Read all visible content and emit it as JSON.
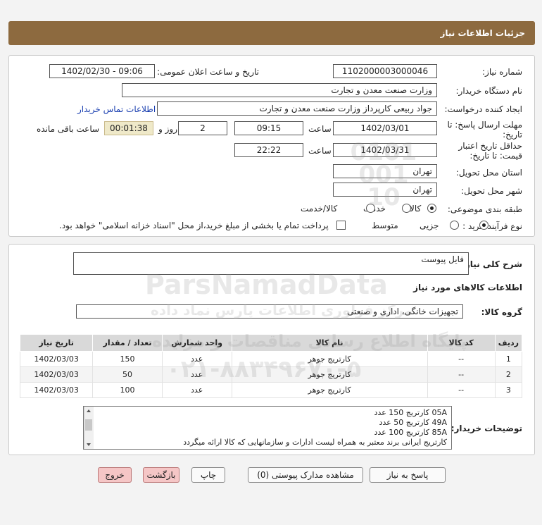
{
  "header": {
    "title": "جزئیات اطلاعات نیاز"
  },
  "form": {
    "need_number_label": "شماره نیاز:",
    "need_number": "1102000003000046",
    "announce_label": "تاریخ و ساعت اعلان عمومی:",
    "announce_value": "1402/02/30 - 09:06",
    "buyer_org_label": "نام دستگاه خریدار:",
    "buyer_org": "وزارت صنعت معدن و تجارت",
    "creator_label": "ایجاد کننده درخواست:",
    "creator": "جواد ربیعی کارپرداز وزارت صنعت معدن و تجارت",
    "contact_link": "اطلاعات تماس خریدار",
    "deadline_label_1": "مهلت ارسال پاسخ: تا",
    "deadline_label_2": "تاریخ:",
    "deadline_date": "1402/03/01",
    "time_label": "ساعت",
    "deadline_time": "09:15",
    "days_value": "2",
    "days_label": "روز و",
    "remaining_time": "00:01:38",
    "remaining_label": "ساعت باقی مانده",
    "validity_label_1": "حداقل تاریخ اعتبار",
    "validity_label_2": "قیمت: تا تاریخ:",
    "validity_date": "1402/03/31",
    "validity_time_label": "ساعت",
    "validity_time": "22:22",
    "province_label": "استان محل تحویل:",
    "province": "تهران",
    "city_label": "شهر محل تحویل:",
    "city": "تهران",
    "category_label": "طبقه بندی موضوعی:",
    "category_options": [
      "کالا",
      "خدمت",
      "کالا/خدمت"
    ],
    "process_label": "نوع فرآیند خرید :",
    "process_options": [
      "جزیی",
      "متوسط"
    ],
    "payment_note": "پرداخت تمام یا بخشی از مبلغ خرید،از محل \"اسناد خزانه اسلامی\" خواهد بود."
  },
  "details": {
    "summary_label": "شرح کلی نیاز:",
    "summary": "فایل پیوست",
    "goods_info_title": "اطلاعات کالاهای مورد نیاز",
    "group_label": "گروه کالا:",
    "group": "تجهیزات خانگی، اداری و صنعتی",
    "table_headers": [
      "ردیف",
      "کد کالا",
      "نام کالا",
      "واحد شمارش",
      "تعداد / مقدار",
      "تاریخ نیاز"
    ],
    "rows": [
      [
        "1",
        "--",
        "کارتریج جوهر",
        "عدد",
        "150",
        "1402/03/03"
      ],
      [
        "2",
        "--",
        "کارتریج جوهر",
        "عدد",
        "50",
        "1402/03/03"
      ],
      [
        "3",
        "--",
        "کارتریج جوهر",
        "عدد",
        "100",
        "1402/03/03"
      ]
    ],
    "buyer_notes_label": "توضیحات خریدار:",
    "buyer_notes": [
      "05A کارتریج  150  عدد",
      "49A  کارتریج 50  عدد",
      "85A  کارتریج  100 عدد",
      "کارتریج ایرانی برند معتبر به همراه لیست ادارات و سازمانهایی که کالا ارائه میگردد"
    ]
  },
  "buttons": {
    "reply": "پاسخ به نیاز",
    "attachments": "مشاهده مدارک پیوستی (0)",
    "print": "چاپ",
    "back": "بازگشت",
    "exit": "خروج"
  },
  "watermark": {
    "brand": "ParsNamadData",
    "persian_1": "مرکز فراوری اطلاعات پارس نماد داده",
    "persian_2": "پایگاه اطلاع رسانی مناقصات و مزایده",
    "phone": "۰۲۱-۸۸۳۴۹۶۷۰-۵",
    "stamp_digits": "0101 001 10"
  }
}
